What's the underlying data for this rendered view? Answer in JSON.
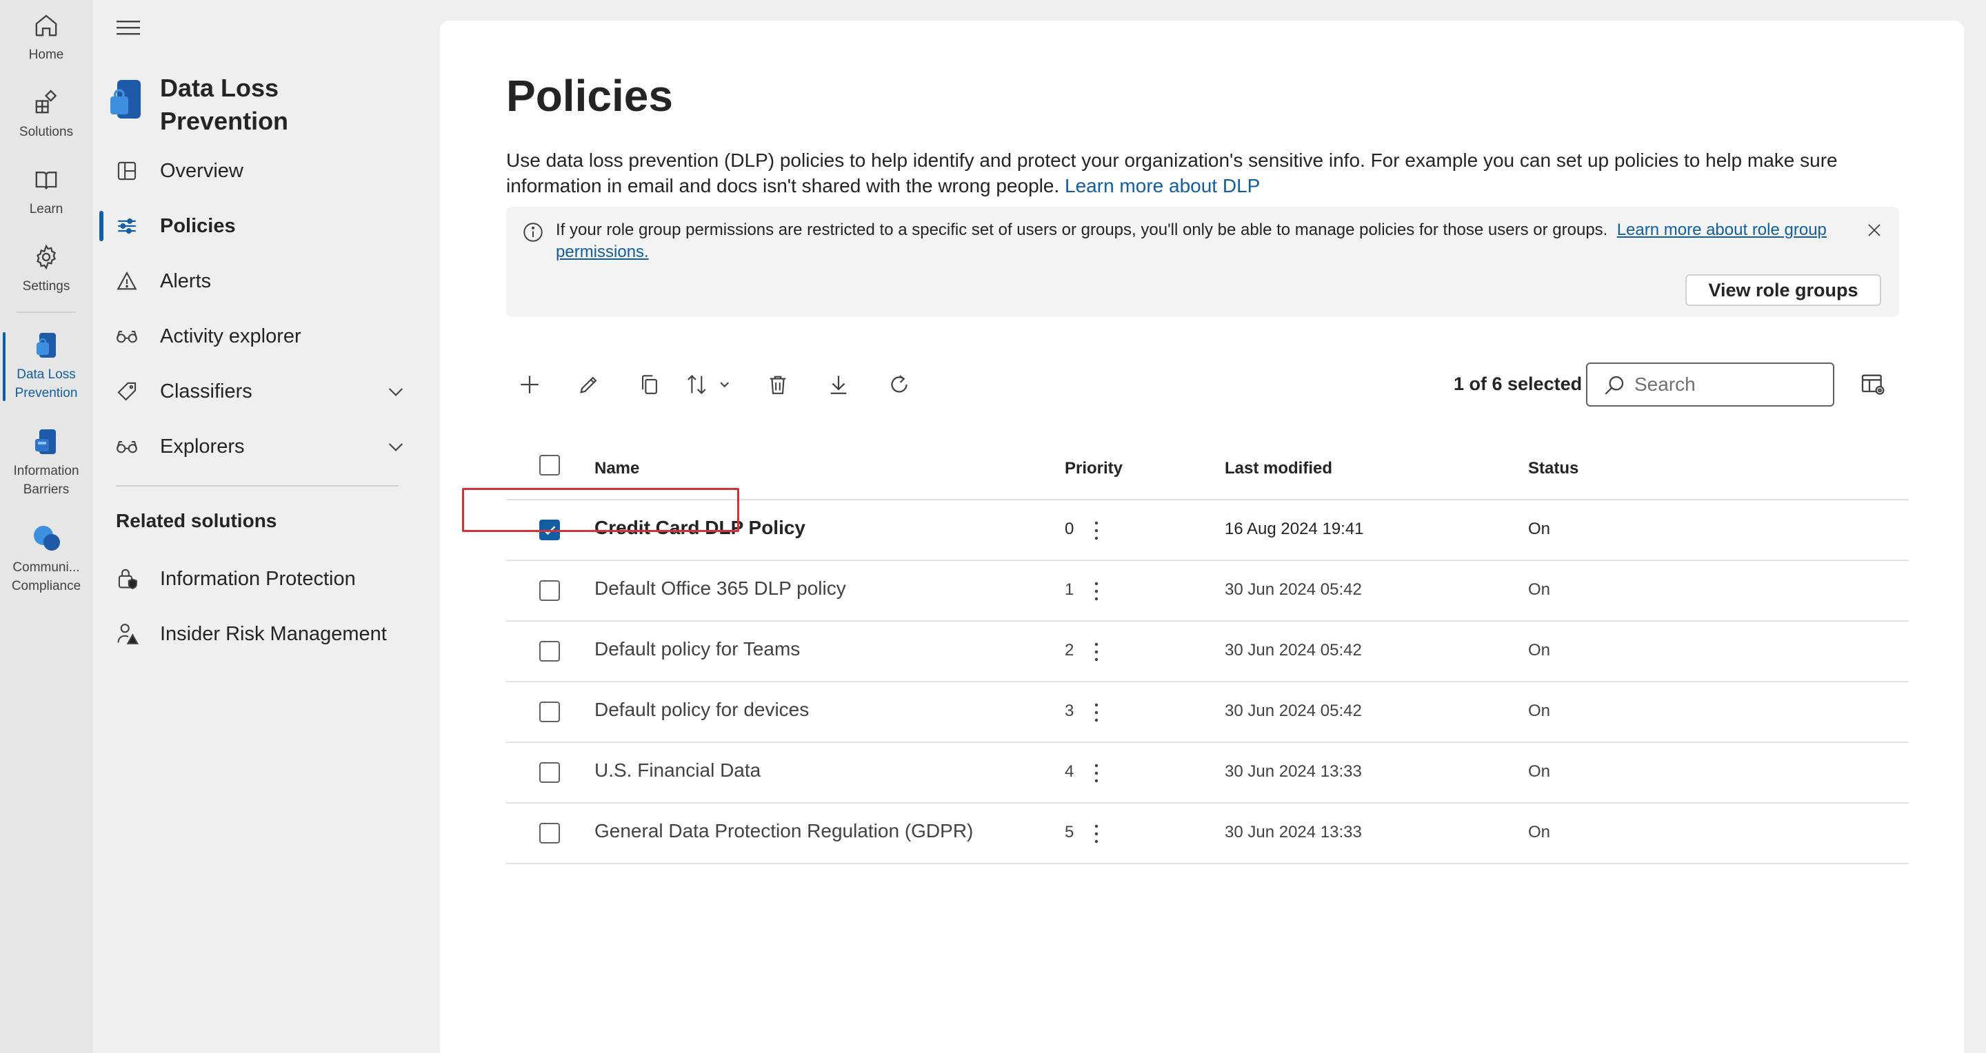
{
  "rail": {
    "items": [
      {
        "label": "Home",
        "icon": "home-icon"
      },
      {
        "label": "Solutions",
        "icon": "solutions-icon"
      },
      {
        "label": "Learn",
        "icon": "book-icon"
      },
      {
        "label": "Settings",
        "icon": "gear-icon"
      },
      {
        "label_line1": "Data Loss",
        "label_line2": "Prevention",
        "icon": "dlp-icon"
      },
      {
        "label_line1": "Information",
        "label_line2": "Barriers",
        "icon": "barriers-icon"
      },
      {
        "label_line1": "Communi...",
        "label_line2": "Compliance",
        "icon": "communication-icon"
      }
    ]
  },
  "subnav": {
    "title_line1": "Data Loss",
    "title_line2": "Prevention",
    "items": [
      {
        "label": "Overview",
        "icon": "overview-icon"
      },
      {
        "label": "Policies",
        "icon": "policies-icon"
      },
      {
        "label": "Alerts",
        "icon": "alert-icon"
      },
      {
        "label": "Activity explorer",
        "icon": "glasses-icon"
      },
      {
        "label": "Classifiers",
        "icon": "tag-icon"
      },
      {
        "label": "Explorers",
        "icon": "glasses-icon"
      }
    ],
    "related_heading": "Related solutions",
    "related": [
      {
        "label": "Information Protection",
        "icon": "lock-shield-icon"
      },
      {
        "label": "Insider Risk Management",
        "icon": "person-warning-icon"
      }
    ]
  },
  "main": {
    "title": "Policies",
    "description": "Use data loss prevention (DLP) policies to help identify and protect your organization's sensitive info. For example you can set up policies to help make sure information in email and docs isn't shared with the wrong people.",
    "description_link": "Learn more about DLP",
    "banner": {
      "text": "If your role group permissions are restricted to a specific set of users or groups, you'll only be able to manage policies for those users or groups.",
      "link": "Learn more about role group permissions.",
      "button": "View role groups"
    },
    "toolbar": {
      "selected_text": "1 of 6 selected",
      "search_placeholder": "Search"
    },
    "table": {
      "columns": {
        "name": "Name",
        "priority": "Priority",
        "modified": "Last modified",
        "status": "Status"
      },
      "rows": [
        {
          "name": "Credit Card DLP Policy",
          "priority": "0",
          "modified": "16 Aug 2024 19:41",
          "status": "On",
          "selected": true
        },
        {
          "name": "Default Office 365 DLP policy",
          "priority": "1",
          "modified": "30 Jun 2024 05:42",
          "status": "On",
          "selected": false
        },
        {
          "name": "Default policy for Teams",
          "priority": "2",
          "modified": "30 Jun 2024 05:42",
          "status": "On",
          "selected": false
        },
        {
          "name": "Default policy for devices",
          "priority": "3",
          "modified": "30 Jun 2024 05:42",
          "status": "On",
          "selected": false
        },
        {
          "name": "U.S. Financial Data",
          "priority": "4",
          "modified": "30 Jun 2024 13:33",
          "status": "On",
          "selected": false
        },
        {
          "name": "General Data Protection Regulation (GDPR)",
          "priority": "5",
          "modified": "30 Jun 2024 13:33",
          "status": "On",
          "selected": false
        }
      ]
    }
  },
  "colors": {
    "accent": "#115ea3",
    "highlight": "#d13438"
  }
}
